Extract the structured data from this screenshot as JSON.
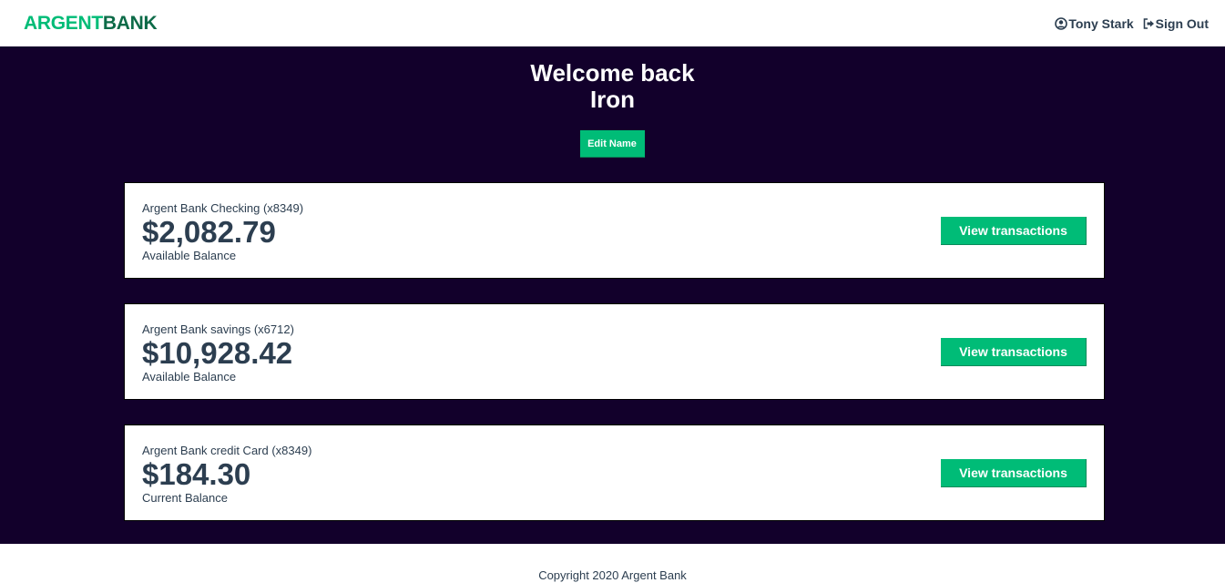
{
  "nav": {
    "logo_part1": "ARGENT",
    "logo_part2": "BANK",
    "user_name": "Tony Stark",
    "signout_label": "Sign Out",
    "user_icon": "user-circle-icon",
    "signout_icon": "sign-out-icon"
  },
  "header": {
    "welcome_line": "Welcome back",
    "first_name": "Iron",
    "edit_label": "Edit Name"
  },
  "accounts": [
    {
      "title": "Argent Bank Checking (x8349)",
      "amount": "$2,082.79",
      "description": "Available Balance",
      "button_label": "View transactions"
    },
    {
      "title": "Argent Bank savings (x6712)",
      "amount": "$10,928.42",
      "description": "Available Balance",
      "button_label": "View transactions"
    },
    {
      "title": "Argent Bank credit Card (x8349)",
      "amount": "$184.30",
      "description": "Current Balance",
      "button_label": "View transactions"
    }
  ],
  "footer": {
    "copyright": "Copyright 2020 Argent Bank"
  },
  "colors": {
    "accent": "#00bc77",
    "brand_dark": "#0d6b48",
    "background_dark": "#12002b",
    "text": "#2c3e50"
  }
}
